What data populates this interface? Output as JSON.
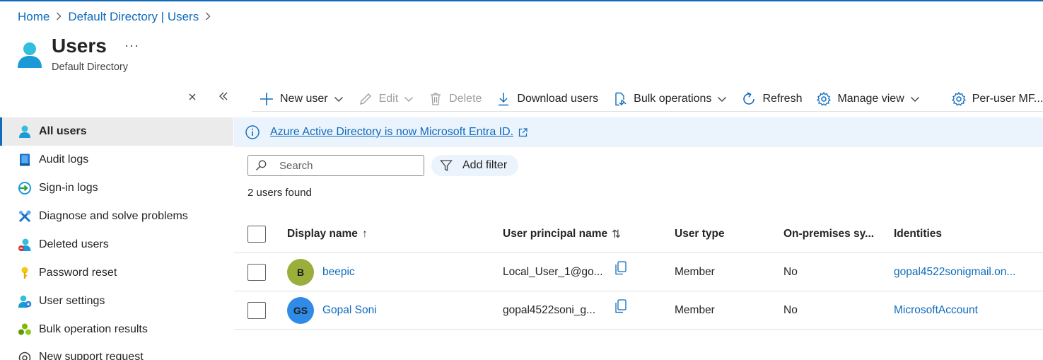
{
  "breadcrumb": {
    "items": [
      "Home",
      "Default Directory | Users"
    ],
    "separator": ">"
  },
  "header": {
    "title": "Users",
    "subtitle": "Default Directory",
    "more_label": "···"
  },
  "sidebar": {
    "close_label": "×",
    "collapse_label": "«",
    "items": [
      {
        "label": "All users",
        "icon": "user-icon",
        "active": true
      },
      {
        "label": "Audit logs",
        "icon": "book-icon"
      },
      {
        "label": "Sign-in logs",
        "icon": "sign-in-icon"
      },
      {
        "label": "Diagnose and solve problems",
        "icon": "wrench-icon"
      },
      {
        "label": "Deleted users",
        "icon": "deleted-user-icon"
      },
      {
        "label": "Password reset",
        "icon": "key-icon"
      },
      {
        "label": "User settings",
        "icon": "user-settings-icon"
      },
      {
        "label": "Bulk operation results",
        "icon": "bulk-results-icon"
      },
      {
        "label": "New support request",
        "icon": "support-icon"
      }
    ]
  },
  "toolbar": {
    "new_user": "New user",
    "edit": "Edit",
    "delete": "Delete",
    "download_users": "Download users",
    "bulk_operations": "Bulk operations",
    "refresh": "Refresh",
    "manage_view": "Manage view",
    "per_user_mfa": "Per-user MF..."
  },
  "banner": {
    "text": "Azure Active Directory is now Microsoft Entra ID."
  },
  "search": {
    "placeholder": "Search",
    "value": ""
  },
  "filter": {
    "label": "Add filter"
  },
  "results": {
    "count_text": "2 users found"
  },
  "table": {
    "columns": [
      "Display name",
      "User principal name",
      "User type",
      "On-premises sy...",
      "Identities"
    ],
    "sort_up": "↑",
    "sort_both": "⇅",
    "rows": [
      {
        "initials": "B",
        "avatar_color": "#9aae3c",
        "display_name": "beepic",
        "upn": "Local_User_1@go...",
        "user_type": "Member",
        "on_prem": "No",
        "identities": "gopal4522sonigmail.on..."
      },
      {
        "initials": "GS",
        "avatar_color": "#2f8be6",
        "display_name": "Gopal Soni",
        "upn": "gopal4522soni_g...",
        "user_type": "Member",
        "on_prem": "No",
        "identities": "MicrosoftAccount"
      }
    ]
  },
  "colors": {
    "accent": "#0f6cbd",
    "banner_bg": "#ebf3fc",
    "active_bg": "#ebebeb"
  }
}
